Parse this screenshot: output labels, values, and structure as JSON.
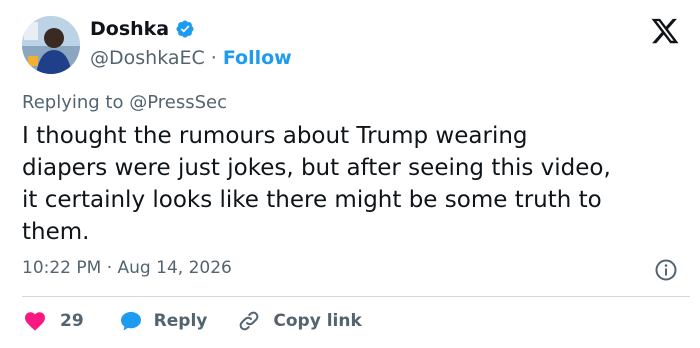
{
  "author": {
    "name": "Doshka",
    "handle": "@DoshkaEC",
    "separator": "·",
    "follow_label": "Follow"
  },
  "reply_context": {
    "prefix": "Replying to ",
    "mention": "@PressSec"
  },
  "tweet": {
    "text": "I thought the rumours about Trump wearing\ndiapers were just jokes, but after seeing this video,\nit certainly looks like there might be some truth to\nthem.",
    "timestamp": "10:22 PM · Aug 14, 2026"
  },
  "actions": {
    "likes": "29",
    "reply_label": "Reply",
    "copy_link_label": "Copy link"
  },
  "icons": {
    "logo": "x-logo-icon",
    "verified": "verified-badge-icon",
    "info": "info-icon",
    "heart": "heart-icon",
    "reply": "reply-bubble-icon",
    "link": "link-icon"
  },
  "colors": {
    "accent": "#1d9bf0",
    "heart": "#f91880",
    "text": "#0f1419",
    "secondary": "#536471"
  }
}
